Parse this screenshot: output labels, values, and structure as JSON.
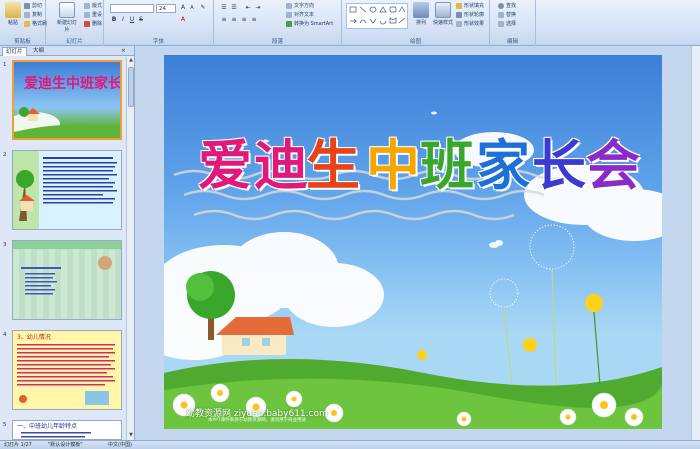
{
  "ribbon": {
    "clipboard": {
      "label": "剪贴板",
      "paste": "粘贴",
      "cut": "剪切",
      "copy": "复制",
      "format_painter": "格式刷"
    },
    "slides": {
      "label": "幻灯片",
      "new_slide": "新建幻灯片",
      "layout": "版式",
      "reset": "重设",
      "delete": "删除"
    },
    "font": {
      "label": "字体",
      "font_name": "",
      "font_size": "24"
    },
    "paragraph": {
      "label": "段落",
      "text_direction": "文字方向",
      "align_text": "对齐文本",
      "smartart": "转换为 SmartArt"
    },
    "drawing": {
      "label": "绘图",
      "arrange": "排列",
      "quick_styles": "快速样式",
      "shape_fill": "形状填充",
      "shape_outline": "形状轮廓",
      "shape_effects": "形状效果"
    },
    "editing": {
      "label": "编辑",
      "find": "查找",
      "replace": "替换",
      "select": "选择"
    }
  },
  "panel": {
    "tab_slides": "幻灯片",
    "tab_outline": "大纲",
    "thumb_numbers": [
      "1",
      "2",
      "3",
      "4",
      "5"
    ]
  },
  "slide": {
    "title_chars": [
      {
        "char": "爱",
        "color": "#e0197a"
      },
      {
        "char": "迪",
        "color": "#e0197a"
      },
      {
        "char": "生",
        "color": "#e84318"
      },
      {
        "char": "中",
        "color": "#f5a600"
      },
      {
        "char": "班",
        "color": "#3aa72c"
      },
      {
        "char": "家",
        "color": "#1f6fd8"
      },
      {
        "char": "长",
        "color": "#3c3ad0"
      },
      {
        "char": "会",
        "color": "#8a2bc7"
      }
    ],
    "watermark": "幼教资源网 ziyuan.baby611.com",
    "watermark_small": "本PPT课件来源于幼教资源网，请勿用于商业用途"
  },
  "thumb2": {
    "heading": "家长会主要内容"
  },
  "thumb3": {
    "heading": "家长会主要内容："
  },
  "thumb4": {
    "heading": "3、幼儿情况"
  },
  "thumb5": {
    "heading": "一、中班幼儿年龄特点"
  },
  "status": {
    "slide_info": "幻灯片 1/27",
    "theme": "\"默认设计模板\"",
    "language": "中文(中国)"
  },
  "colors": {
    "ribbon_bg": "#d3e1f4",
    "selected_border": "#f0a030",
    "sky": "#5ea2ea",
    "grass": "#5fb53a"
  }
}
